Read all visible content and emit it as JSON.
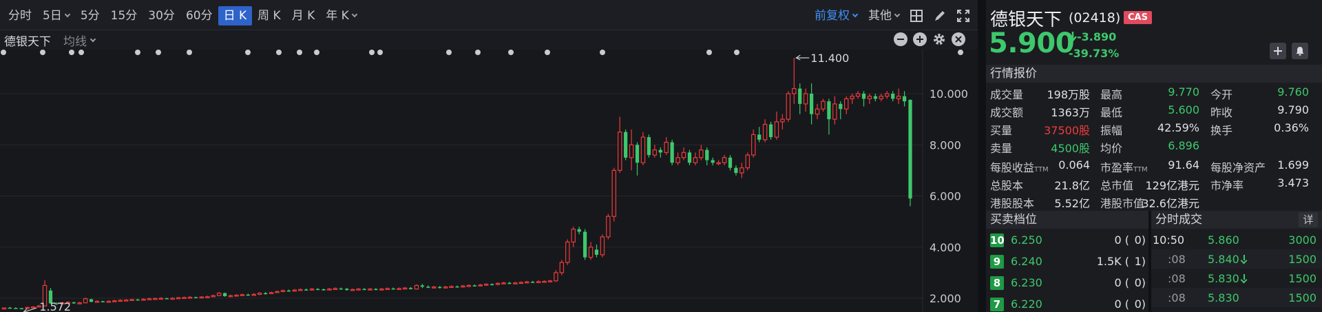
{
  "toolbar": {
    "tabs": [
      {
        "label": "分时",
        "dropdown": false,
        "active": false
      },
      {
        "label": "5日",
        "dropdown": true,
        "active": false
      },
      {
        "label": "5分",
        "dropdown": false,
        "active": false
      },
      {
        "label": "15分",
        "dropdown": false,
        "active": false
      },
      {
        "label": "30分",
        "dropdown": false,
        "active": false
      },
      {
        "label": "60分",
        "dropdown": false,
        "active": false
      },
      {
        "label": "日 K",
        "dropdown": false,
        "active": true
      },
      {
        "label": "周 K",
        "dropdown": false,
        "active": false
      },
      {
        "label": "月 K",
        "dropdown": false,
        "active": false
      },
      {
        "label": "年 K",
        "dropdown": true,
        "active": false
      }
    ],
    "adjust": "前复权",
    "more": "其他",
    "icons": [
      "grid-layout-icon",
      "pen-draw-icon",
      "fullscreen-icon"
    ]
  },
  "subbar": {
    "name": "德银天下",
    "indicator": "均线"
  },
  "chart_data": {
    "type": "candlestick",
    "yticks": [
      "10.000",
      "8.000",
      "6.000",
      "4.000",
      "2.000"
    ],
    "ymin": 1.4,
    "ymax": 11.6,
    "high_annotation": "11.400",
    "low_annotation": "1.572",
    "up_color": "#ee3b3b",
    "down_color": "#3ec86c",
    "candles": [
      [
        1.62,
        1.62,
        1.64,
        1.58
      ],
      [
        1.63,
        1.62,
        1.66,
        1.6
      ],
      [
        1.62,
        1.61,
        1.64,
        1.58
      ],
      [
        1.61,
        1.6,
        1.62,
        1.57
      ],
      [
        1.6,
        1.64,
        1.67,
        1.57
      ],
      [
        1.64,
        1.66,
        1.69,
        1.62
      ],
      [
        1.66,
        1.7,
        1.74,
        1.64
      ],
      [
        1.7,
        2.5,
        2.7,
        1.68
      ],
      [
        2.3,
        1.8,
        2.4,
        1.78
      ],
      [
        1.8,
        1.78,
        1.84,
        1.74
      ],
      [
        1.78,
        1.82,
        1.86,
        1.76
      ],
      [
        1.82,
        1.84,
        1.88,
        1.8
      ],
      [
        1.84,
        1.8,
        1.86,
        1.78
      ],
      [
        1.8,
        1.82,
        1.86,
        1.78
      ],
      [
        1.82,
        1.98,
        2.02,
        1.8
      ],
      [
        1.96,
        1.86,
        1.98,
        1.84
      ],
      [
        1.86,
        1.88,
        1.92,
        1.84
      ],
      [
        1.88,
        1.86,
        1.9,
        1.84
      ],
      [
        1.86,
        1.88,
        1.92,
        1.84
      ],
      [
        1.88,
        1.9,
        1.94,
        1.86
      ],
      [
        1.9,
        1.92,
        1.96,
        1.88
      ],
      [
        1.92,
        1.93,
        1.96,
        1.9
      ],
      [
        1.93,
        1.95,
        1.98,
        1.9
      ],
      [
        1.95,
        1.94,
        1.98,
        1.92
      ],
      [
        1.94,
        1.96,
        2.0,
        1.92
      ],
      [
        1.96,
        1.98,
        2.02,
        1.94
      ],
      [
        1.98,
        1.99,
        2.02,
        1.96
      ],
      [
        1.99,
        2.0,
        2.04,
        1.96
      ],
      [
        2.0,
        1.98,
        2.02,
        1.96
      ],
      [
        1.98,
        2.0,
        2.04,
        1.96
      ],
      [
        2.0,
        2.02,
        2.05,
        1.98
      ],
      [
        2.02,
        2.03,
        2.06,
        2.0
      ],
      [
        2.03,
        2.04,
        2.08,
        2.0
      ],
      [
        2.04,
        2.02,
        2.06,
        2.0
      ],
      [
        2.02,
        2.05,
        2.08,
        2.0
      ],
      [
        2.05,
        2.06,
        2.1,
        2.02
      ],
      [
        2.06,
        2.1,
        2.14,
        2.04
      ],
      [
        2.1,
        2.2,
        2.24,
        2.08
      ],
      [
        2.2,
        2.08,
        2.22,
        2.06
      ],
      [
        2.08,
        2.1,
        2.14,
        2.06
      ],
      [
        2.1,
        2.12,
        2.16,
        2.08
      ],
      [
        2.12,
        2.14,
        2.18,
        2.1
      ],
      [
        2.14,
        2.13,
        2.18,
        2.1
      ],
      [
        2.13,
        2.15,
        2.2,
        2.1
      ],
      [
        2.15,
        2.2,
        2.24,
        2.12
      ],
      [
        2.2,
        2.18,
        2.24,
        2.14
      ],
      [
        2.18,
        2.22,
        2.26,
        2.16
      ],
      [
        2.22,
        2.26,
        2.3,
        2.2
      ],
      [
        2.26,
        2.3,
        2.34,
        2.24
      ],
      [
        2.3,
        2.28,
        2.34,
        2.26
      ],
      [
        2.28,
        2.32,
        2.36,
        2.26
      ],
      [
        2.32,
        2.34,
        2.38,
        2.3
      ],
      [
        2.34,
        2.33,
        2.38,
        2.3
      ],
      [
        2.33,
        2.36,
        2.4,
        2.3
      ],
      [
        2.36,
        2.35,
        2.4,
        2.32
      ],
      [
        2.35,
        2.34,
        2.38,
        2.3
      ],
      [
        2.34,
        2.36,
        2.4,
        2.32
      ],
      [
        2.36,
        2.38,
        2.42,
        2.34
      ],
      [
        2.38,
        2.37,
        2.42,
        2.34
      ],
      [
        2.37,
        2.32,
        2.4,
        2.3
      ],
      [
        2.32,
        2.34,
        2.38,
        2.3
      ],
      [
        2.34,
        2.36,
        2.4,
        2.32
      ],
      [
        2.36,
        2.35,
        2.4,
        2.32
      ],
      [
        2.35,
        2.36,
        2.4,
        2.32
      ],
      [
        2.36,
        2.34,
        2.4,
        2.32
      ],
      [
        2.34,
        2.36,
        2.4,
        2.32
      ],
      [
        2.36,
        2.38,
        2.42,
        2.34
      ],
      [
        2.38,
        2.36,
        2.42,
        2.34
      ],
      [
        2.36,
        2.38,
        2.42,
        2.34
      ],
      [
        2.38,
        2.4,
        2.44,
        2.36
      ],
      [
        2.4,
        2.36,
        2.44,
        2.34
      ],
      [
        2.36,
        2.5,
        2.54,
        2.34
      ],
      [
        2.5,
        2.45,
        2.56,
        2.4
      ],
      [
        2.45,
        2.42,
        2.5,
        2.4
      ],
      [
        2.42,
        2.44,
        2.48,
        2.4
      ],
      [
        2.44,
        2.42,
        2.48,
        2.38
      ],
      [
        2.42,
        2.44,
        2.48,
        2.4
      ],
      [
        2.44,
        2.46,
        2.5,
        2.42
      ],
      [
        2.46,
        2.45,
        2.5,
        2.42
      ],
      [
        2.45,
        2.48,
        2.52,
        2.42
      ],
      [
        2.48,
        2.5,
        2.54,
        2.44
      ],
      [
        2.5,
        2.49,
        2.54,
        2.46
      ],
      [
        2.49,
        2.52,
        2.56,
        2.46
      ],
      [
        2.52,
        2.55,
        2.58,
        2.48
      ],
      [
        2.55,
        2.54,
        2.58,
        2.5
      ],
      [
        2.54,
        2.58,
        2.62,
        2.5
      ],
      [
        2.58,
        2.6,
        2.64,
        2.54
      ],
      [
        2.6,
        2.58,
        2.64,
        2.55
      ],
      [
        2.58,
        2.6,
        2.64,
        2.55
      ],
      [
        2.6,
        2.62,
        2.66,
        2.56
      ],
      [
        2.62,
        2.64,
        2.68,
        2.58
      ],
      [
        2.64,
        2.63,
        2.68,
        2.6
      ],
      [
        2.63,
        2.65,
        2.7,
        2.6
      ],
      [
        2.65,
        2.66,
        2.7,
        2.62
      ],
      [
        2.66,
        2.68,
        2.72,
        2.62
      ],
      [
        2.68,
        3.0,
        3.1,
        2.64
      ],
      [
        3.0,
        3.4,
        3.5,
        2.9
      ],
      [
        3.4,
        4.2,
        4.3,
        3.3
      ],
      [
        4.2,
        4.7,
        4.8,
        4.0
      ],
      [
        4.7,
        4.6,
        4.8,
        4.5
      ],
      [
        4.6,
        3.6,
        4.7,
        3.5
      ],
      [
        3.6,
        4.0,
        4.2,
        3.5
      ],
      [
        3.9,
        3.7,
        4.1,
        3.6
      ],
      [
        3.7,
        4.4,
        4.5,
        3.6
      ],
      [
        4.4,
        5.2,
        5.3,
        4.3
      ],
      [
        5.2,
        7.0,
        7.1,
        5.0
      ],
      [
        7.0,
        8.5,
        9.1,
        6.9
      ],
      [
        8.5,
        7.5,
        8.6,
        7.4
      ],
      [
        7.5,
        8.0,
        8.6,
        7.0
      ],
      [
        8.0,
        7.3,
        8.1,
        6.8
      ],
      [
        7.3,
        8.3,
        8.5,
        7.2
      ],
      [
        8.3,
        7.6,
        8.4,
        7.5
      ],
      [
        7.6,
        7.8,
        8.0,
        7.5
      ],
      [
        7.8,
        7.7,
        7.9,
        7.5
      ],
      [
        7.7,
        8.1,
        8.3,
        7.6
      ],
      [
        8.1,
        7.3,
        8.2,
        7.2
      ],
      [
        7.3,
        7.5,
        7.7,
        7.2
      ],
      [
        7.5,
        7.7,
        7.9,
        7.4
      ],
      [
        7.7,
        7.3,
        7.8,
        7.2
      ],
      [
        7.3,
        7.5,
        7.7,
        7.2
      ],
      [
        7.5,
        7.8,
        8.0,
        7.4
      ],
      [
        7.8,
        7.4,
        7.9,
        7.2
      ],
      [
        7.4,
        7.3,
        7.5,
        7.2
      ],
      [
        7.3,
        7.3,
        7.4,
        7.2
      ],
      [
        7.3,
        7.5,
        7.6,
        7.2
      ],
      [
        7.5,
        7.1,
        7.6,
        7.0
      ],
      [
        7.1,
        6.9,
        7.2,
        6.8
      ],
      [
        6.9,
        7.1,
        7.3,
        6.7
      ],
      [
        7.1,
        7.6,
        7.7,
        7.0
      ],
      [
        7.6,
        8.4,
        8.6,
        7.5
      ],
      [
        8.4,
        8.2,
        8.7,
        8.1
      ],
      [
        8.2,
        8.8,
        9.0,
        8.1
      ],
      [
        8.8,
        8.3,
        8.9,
        8.2
      ],
      [
        8.3,
        8.9,
        9.3,
        8.2
      ],
      [
        8.9,
        9.0,
        9.2,
        8.6
      ],
      [
        9.0,
        10.0,
        10.1,
        8.9
      ],
      [
        10.0,
        10.2,
        11.4,
        9.6
      ],
      [
        10.2,
        9.6,
        10.4,
        9.2
      ],
      [
        9.6,
        10.0,
        10.2,
        9.3
      ],
      [
        10.0,
        9.2,
        10.4,
        8.8
      ],
      [
        9.2,
        9.4,
        9.6,
        9.0
      ],
      [
        9.4,
        9.7,
        9.8,
        9.3
      ],
      [
        9.7,
        9.0,
        9.8,
        8.4
      ],
      [
        9.0,
        9.6,
        9.9,
        8.8
      ],
      [
        9.6,
        9.4,
        9.7,
        9.0
      ],
      [
        9.4,
        9.8,
        9.9,
        9.2
      ],
      [
        9.8,
        9.9,
        10.0,
        9.6
      ],
      [
        9.9,
        10.0,
        10.1,
        9.8
      ],
      [
        10.0,
        9.8,
        10.1,
        9.5
      ],
      [
        9.8,
        9.9,
        10.0,
        9.6
      ],
      [
        9.9,
        9.8,
        10.0,
        9.7
      ],
      [
        9.8,
        9.9,
        10.0,
        9.7
      ],
      [
        9.9,
        10.0,
        10.1,
        9.8
      ],
      [
        10.0,
        9.8,
        10.1,
        9.7
      ],
      [
        9.8,
        9.9,
        10.2,
        9.6
      ],
      [
        9.9,
        9.7,
        10.1,
        9.5
      ],
      [
        9.76,
        5.9,
        9.77,
        5.6
      ]
    ],
    "flags": [
      5,
      62,
      104,
      118,
      200,
      230,
      275,
      360,
      405,
      435,
      460,
      540,
      552,
      652,
      694,
      742,
      795,
      875,
      1030,
      1070,
      1395
    ]
  },
  "quote": {
    "name": "德银天下",
    "code": "(02418)",
    "badge": "CAS",
    "price": "5.900",
    "change": "-3.890",
    "change_pct": "-39.73%"
  },
  "sections": {
    "market": "行情报价",
    "orderbook": "买卖档位",
    "trades": "分时成交",
    "detail": "详"
  },
  "stats": [
    [
      {
        "l": "成交量",
        "v": "198万股",
        "c": ""
      },
      {
        "l": "最高",
        "v": "9.770",
        "c": "g"
      },
      {
        "l": "今开",
        "v": "9.760",
        "c": "g"
      }
    ],
    [
      {
        "l": "成交额",
        "v": "1363万",
        "c": ""
      },
      {
        "l": "最低",
        "v": "5.600",
        "c": "g"
      },
      {
        "l": "昨收",
        "v": "9.790",
        "c": ""
      }
    ],
    [
      {
        "l": "买量",
        "v": "37500股",
        "c": "r"
      },
      {
        "l": "振幅",
        "v": "42.59%",
        "c": ""
      },
      {
        "l": "换手",
        "v": "0.36%",
        "c": ""
      }
    ],
    [
      {
        "l": "卖量",
        "v": "4500股",
        "c": "g"
      },
      {
        "l": "均价",
        "v": "6.896",
        "c": "g"
      },
      null
    ],
    [
      {
        "l": "每股收益",
        "ttm": "TTM",
        "v": "0.064",
        "c": ""
      },
      {
        "l": "市盈率",
        "ttm": "TTM",
        "v": "91.64",
        "c": ""
      },
      {
        "l": "每股净资产",
        "v": "1.699",
        "c": ""
      }
    ],
    [
      {
        "l": "总股本",
        "v": "21.8亿",
        "c": ""
      },
      {
        "l": "总市值",
        "v": "129亿港元",
        "c": ""
      },
      {
        "l": "市净率",
        "v": "3.473",
        "c": ""
      }
    ],
    [
      {
        "l": "港股股本",
        "v": "5.52亿",
        "c": ""
      },
      {
        "l": "港股市值",
        "v": "32.6亿港元",
        "c": ""
      },
      null
    ]
  ],
  "orderbook": [
    {
      "level": "10",
      "price": "6.250",
      "qty": "0 (",
      "count": "0)"
    },
    {
      "level": "9",
      "price": "6.240",
      "qty": "1.5K (",
      "count": "1)"
    },
    {
      "level": "8",
      "price": "6.230",
      "qty": "0 (",
      "count": "0)"
    },
    {
      "level": "7",
      "price": "6.220",
      "qty": "0 (",
      "count": "0)"
    }
  ],
  "trades": [
    {
      "time": "10:50",
      "price": "5.860",
      "arrow": false,
      "vol": "3000"
    },
    {
      "time": ":08",
      "price": "5.840",
      "arrow": true,
      "vol": "1500"
    },
    {
      "time": ":08",
      "price": "5.830",
      "arrow": true,
      "vol": "1500"
    },
    {
      "time": ":08",
      "price": "5.830",
      "arrow": false,
      "vol": "1500"
    }
  ]
}
